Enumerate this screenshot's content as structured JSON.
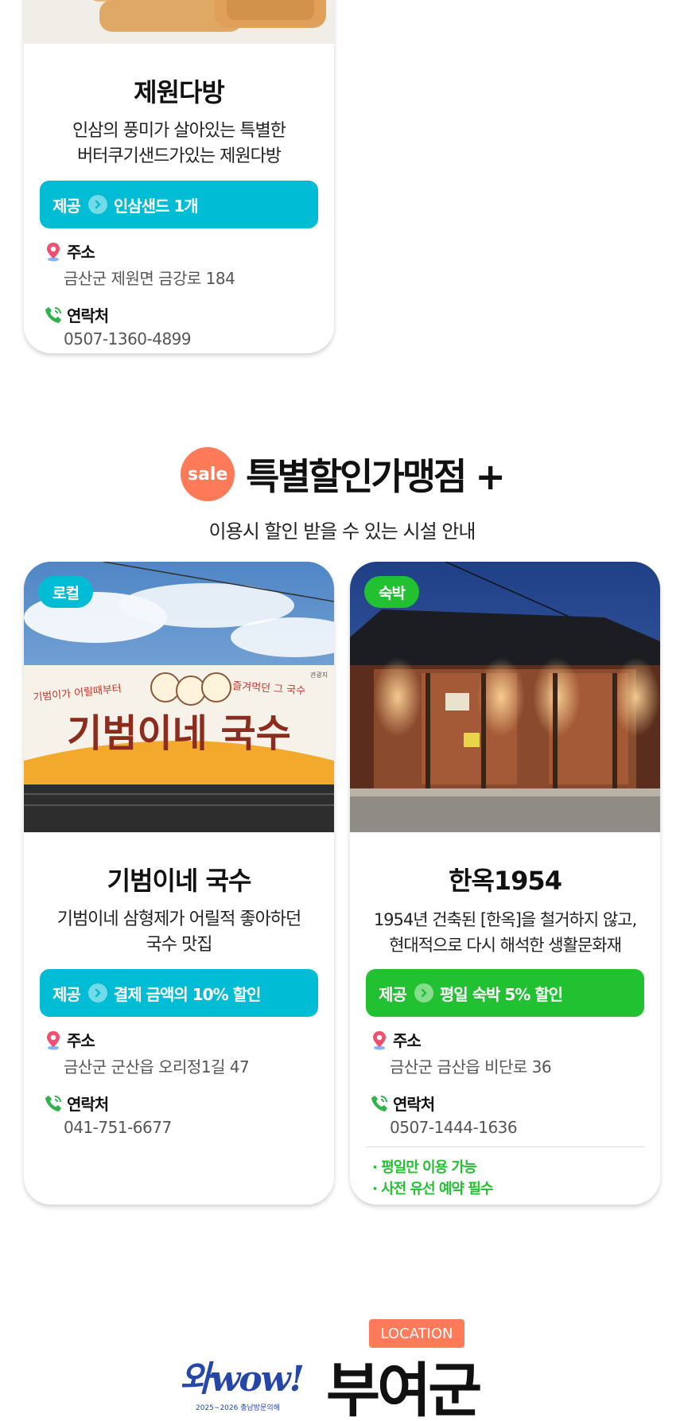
{
  "cards": {
    "jewon": {
      "title": "제원다방",
      "desc_line1": "인삼의 풍미가 살아있는 특별한",
      "desc_line2": "버터쿠기샌드가있는 제원다방",
      "offer_label": "제공",
      "offer_text": "인삼샌드 1개",
      "address_label": "주소",
      "address": "금산군 제원면 금강로 184",
      "contact_label": "연락처",
      "phone": "0507-1360-4899"
    },
    "gibeom": {
      "tag": "로컬",
      "title": "기범이네 국수",
      "desc_line1": "기범이네 삼형제가 어릴적 좋아하던",
      "desc_line2": "국수 맛집",
      "offer_label": "제공",
      "offer_text": "결제 금액의 10% 할인",
      "address_label": "주소",
      "address": "금산군 군산읍 오리정1길 47",
      "contact_label": "연락처",
      "phone": "041-751-6677",
      "sign_main": "기범이네 국수",
      "sign_left": "기범이가 어릴때부터",
      "sign_right": "즐겨먹던 그 국수",
      "sign_corner": "관광지"
    },
    "hanok": {
      "tag": "숙박",
      "title": "한옥1954",
      "desc_line1": "1954년 건축된 [한옥]을 철거하지 않고,",
      "desc_line2": "현대적으로 다시 해석한 생활문화재",
      "offer_label": "제공",
      "offer_text": "평일 숙박 5% 할인",
      "address_label": "주소",
      "address": "금산군 금산읍 비단로 36",
      "contact_label": "연락처",
      "phone": "0507-1444-1636",
      "notes": [
        "· 평일만 이용 가능",
        "· 사전 유선 예약 필수"
      ]
    }
  },
  "section": {
    "sale_badge": "sale",
    "title": "특별할인가맹점 +",
    "subtitle": "이용시 할인 받을 수 있는 시설 안내"
  },
  "location": {
    "badge": "LOCATION",
    "logo_text": "와wow!",
    "logo_sub": "2025~2026 충남방문의해",
    "region": "부여군"
  },
  "colors": {
    "cyan": "#00bcd4",
    "green": "#22c132",
    "sale": "#ff7a59",
    "location": "#ff7a59"
  },
  "icons": [
    "map-pin-icon",
    "phone-icon",
    "chevron-right-icon"
  ]
}
